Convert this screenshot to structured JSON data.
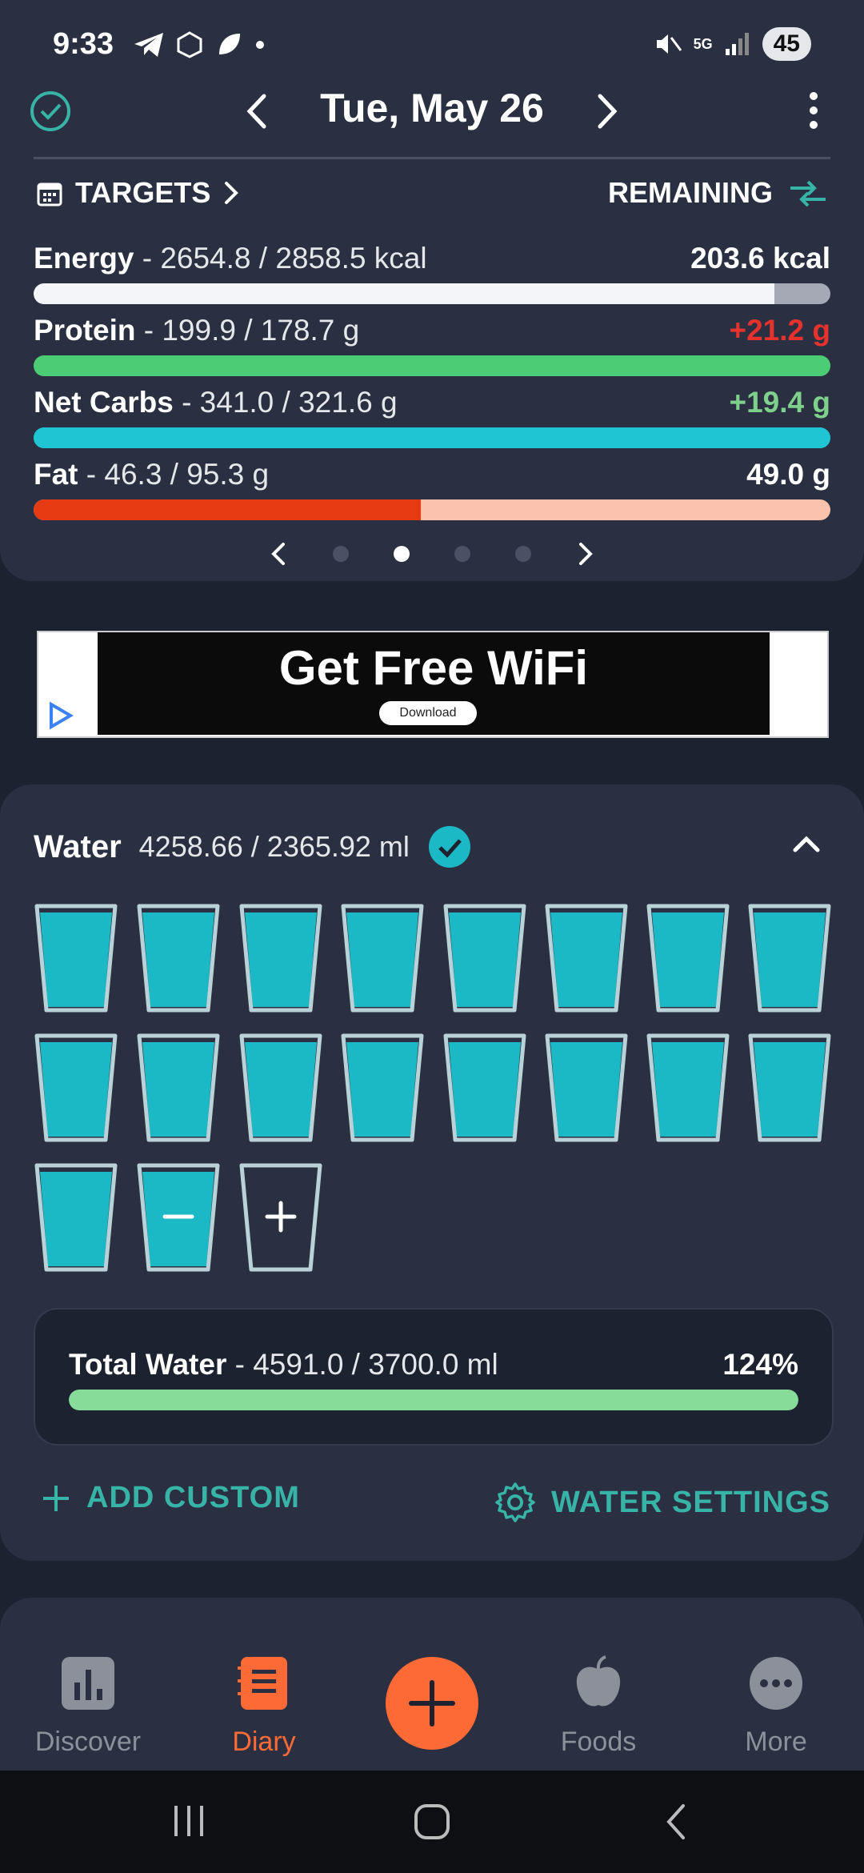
{
  "status_bar": {
    "time": "9:33",
    "battery": "45",
    "network": "5G"
  },
  "header": {
    "date": "Tue, May 26"
  },
  "targets": {
    "label": "TARGETS",
    "remaining_label": "REMAINING"
  },
  "nutrients": [
    {
      "name": "Energy",
      "values": "- 2654.8 / 2858.5 kcal",
      "remaining": "203.6 kcal",
      "remaining_color": "#ffffff",
      "bar_fill": 0.93,
      "fill_color": "#f4f5f8",
      "track_color": "#a5a9b6"
    },
    {
      "name": "Protein",
      "values": "- 199.9 / 178.7 g",
      "remaining": "+21.2 g",
      "remaining_color": "#e6322d",
      "bar_fill": 1.0,
      "fill_color": "#4ccc74",
      "track_color": "#4ccc74"
    },
    {
      "name": "Net Carbs",
      "values": "- 341.0 / 321.6 g",
      "remaining": "+19.4 g",
      "remaining_color": "#7ed08c",
      "bar_fill": 1.0,
      "fill_color": "#20c5d4",
      "track_color": "#20c5d4"
    },
    {
      "name": "Fat",
      "values": "- 46.3 / 95.3 g",
      "remaining": "49.0 g",
      "remaining_color": "#ffffff",
      "bar_fill": 0.486,
      "fill_color": "#e63b12",
      "track_color": "#fbc2ad"
    }
  ],
  "pager": {
    "count": 4,
    "active": 1
  },
  "ad": {
    "headline": "Get Free WiFi",
    "button": "Download"
  },
  "water": {
    "title": "Water",
    "amount": "4258.66 / 2365.92 ml",
    "cups_filled": 18,
    "total_label": "Total Water",
    "total_values": "- 4591.0 / 3700.0 ml",
    "total_percent": "124%",
    "total_fill": 1.0,
    "add_custom": "ADD CUSTOM",
    "settings": "WATER SETTINGS"
  },
  "nav": {
    "items": [
      {
        "label": "Discover",
        "active": false
      },
      {
        "label": "Diary",
        "active": true
      },
      {
        "label": "Foods",
        "active": false
      },
      {
        "label": "More",
        "active": false
      }
    ]
  },
  "colors": {
    "accent": "#37b4a6",
    "fab": "#fe6a35",
    "active_nav": "#fe6a35",
    "water_cup": "#1bb8c6"
  }
}
